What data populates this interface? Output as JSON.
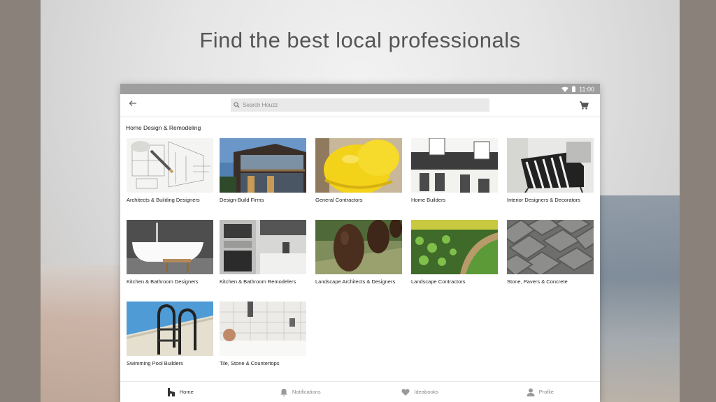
{
  "headline": "Find the best local professionals",
  "status": {
    "time": "11:00"
  },
  "appbar": {
    "search_placeholder": "Search Houzz"
  },
  "section_title": "Home Design & Remodeling",
  "categories": [
    "Architects & Building Designers",
    "Design-Build Firms",
    "General Contractors",
    "Home Builders",
    "Interior Designers & Decorators",
    "Kitchen & Bathroom Designers",
    "Kitchen & Bathroom Remodelers",
    "Landscape Architects & Designers",
    "Landscape Contractors",
    "Stone, Pavers & Concrete",
    "Swimming Pool Builders",
    "Tile, Stone & Countertops"
  ],
  "bottom_nav": [
    {
      "label": "Home",
      "icon": "houzz-home-icon",
      "active": true
    },
    {
      "label": "Notifications",
      "icon": "bell-icon",
      "active": false
    },
    {
      "label": "Ideabooks",
      "icon": "heart-icon",
      "active": false
    },
    {
      "label": "Profile",
      "icon": "person-icon",
      "active": false
    }
  ],
  "colors": {
    "status_bar": "#9e9e9e",
    "accent": "#333333"
  }
}
